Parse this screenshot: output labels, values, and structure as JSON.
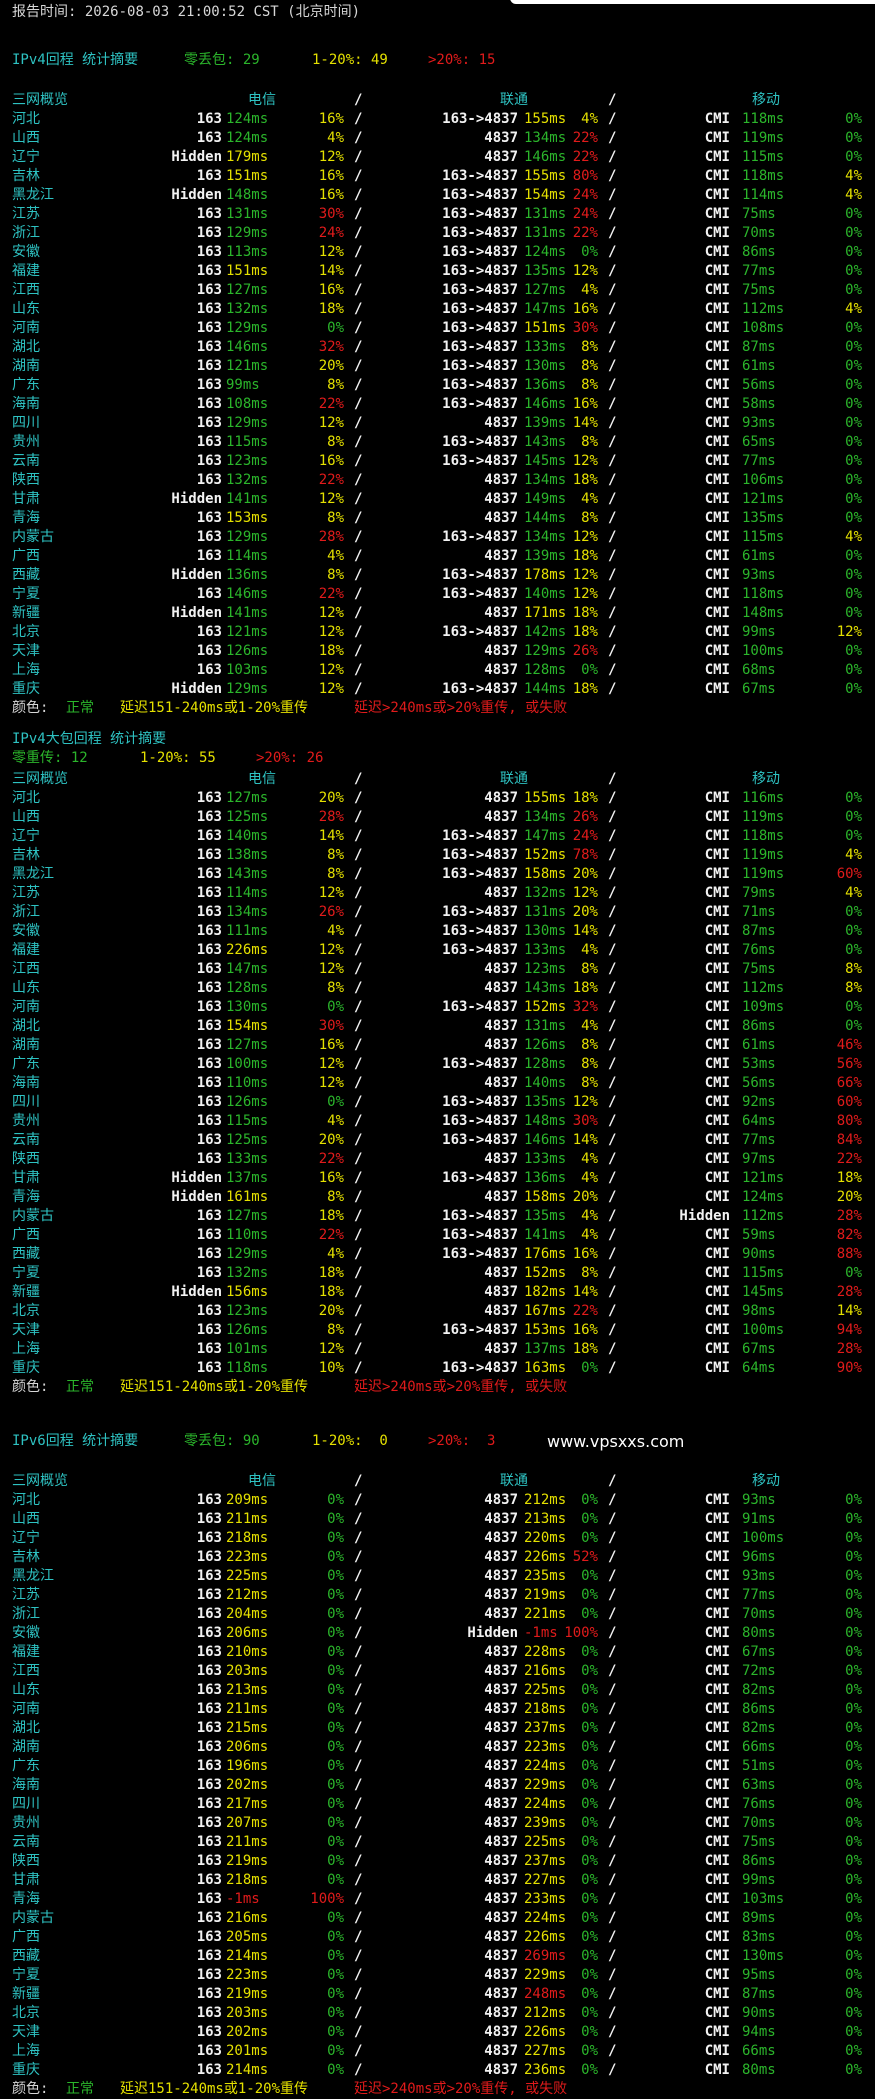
{
  "report_label": "报告时间:",
  "report_time": "2026-08-03 21:00:52 CST (北京时间)",
  "watermark": "www.vpsxxs.com",
  "headers": {
    "region": "三网概览",
    "telecom": "电信",
    "unicom": "联通",
    "mobile": "移动",
    "slash": "/"
  },
  "legend": {
    "label": "颜色:",
    "normal": "正常",
    "warn": "延迟151-240ms或1-20%重传",
    "bad": "延迟>240ms或>20%重传, 或失败"
  },
  "sections": [
    {
      "title": "IPv4回程",
      "subtitle": "统计摘要",
      "summary": [
        {
          "text": "零丢包: 29",
          "tone": "g"
        },
        {
          "text": "1-20%: 49",
          "tone": "y"
        },
        {
          "text": ">20%: 15",
          "tone": "rd"
        }
      ],
      "rows": [
        [
          "河北",
          "163",
          "124ms",
          "16%",
          "163->4837",
          "155ms",
          "4%",
          "CMI",
          "118ms",
          "0%"
        ],
        [
          "山西",
          "163",
          "124ms",
          "4%",
          "4837",
          "134ms",
          "22%",
          "CMI",
          "119ms",
          "0%"
        ],
        [
          "辽宁",
          "Hidden",
          "179ms",
          "12%",
          "4837",
          "146ms",
          "22%",
          "CMI",
          "115ms",
          "0%"
        ],
        [
          "吉林",
          "163",
          "151ms",
          "16%",
          "163->4837",
          "155ms",
          "80%",
          "CMI",
          "118ms",
          "4%"
        ],
        [
          "黑龙江",
          "Hidden",
          "148ms",
          "16%",
          "163->4837",
          "154ms",
          "24%",
          "CMI",
          "114ms",
          "4%"
        ],
        [
          "江苏",
          "163",
          "131ms",
          "30%",
          "163->4837",
          "131ms",
          "24%",
          "CMI",
          "75ms",
          "0%"
        ],
        [
          "浙江",
          "163",
          "129ms",
          "24%",
          "163->4837",
          "131ms",
          "22%",
          "CMI",
          "70ms",
          "0%"
        ],
        [
          "安徽",
          "163",
          "113ms",
          "12%",
          "163->4837",
          "124ms",
          "0%",
          "CMI",
          "86ms",
          "0%"
        ],
        [
          "福建",
          "163",
          "151ms",
          "14%",
          "163->4837",
          "135ms",
          "12%",
          "CMI",
          "77ms",
          "0%"
        ],
        [
          "江西",
          "163",
          "127ms",
          "16%",
          "163->4837",
          "127ms",
          "4%",
          "CMI",
          "75ms",
          "0%"
        ],
        [
          "山东",
          "163",
          "132ms",
          "18%",
          "163->4837",
          "147ms",
          "16%",
          "CMI",
          "112ms",
          "4%"
        ],
        [
          "河南",
          "163",
          "129ms",
          "0%",
          "163->4837",
          "151ms",
          "30%",
          "CMI",
          "108ms",
          "0%"
        ],
        [
          "湖北",
          "163",
          "146ms",
          "32%",
          "163->4837",
          "133ms",
          "8%",
          "CMI",
          "87ms",
          "0%"
        ],
        [
          "湖南",
          "163",
          "121ms",
          "20%",
          "163->4837",
          "130ms",
          "8%",
          "CMI",
          "61ms",
          "0%"
        ],
        [
          "广东",
          "163",
          "99ms",
          "8%",
          "163->4837",
          "136ms",
          "8%",
          "CMI",
          "56ms",
          "0%"
        ],
        [
          "海南",
          "163",
          "108ms",
          "22%",
          "163->4837",
          "146ms",
          "16%",
          "CMI",
          "58ms",
          "0%"
        ],
        [
          "四川",
          "163",
          "129ms",
          "12%",
          "4837",
          "139ms",
          "14%",
          "CMI",
          "93ms",
          "0%"
        ],
        [
          "贵州",
          "163",
          "115ms",
          "8%",
          "163->4837",
          "143ms",
          "8%",
          "CMI",
          "65ms",
          "0%"
        ],
        [
          "云南",
          "163",
          "123ms",
          "16%",
          "163->4837",
          "145ms",
          "12%",
          "CMI",
          "77ms",
          "0%"
        ],
        [
          "陕西",
          "163",
          "132ms",
          "22%",
          "4837",
          "134ms",
          "18%",
          "CMI",
          "106ms",
          "0%"
        ],
        [
          "甘肃",
          "Hidden",
          "141ms",
          "12%",
          "4837",
          "149ms",
          "4%",
          "CMI",
          "121ms",
          "0%"
        ],
        [
          "青海",
          "163",
          "153ms",
          "8%",
          "4837",
          "144ms",
          "8%",
          "CMI",
          "135ms",
          "0%"
        ],
        [
          "内蒙古",
          "163",
          "129ms",
          "28%",
          "163->4837",
          "134ms",
          "12%",
          "CMI",
          "115ms",
          "4%"
        ],
        [
          "广西",
          "163",
          "114ms",
          "4%",
          "4837",
          "139ms",
          "18%",
          "CMI",
          "61ms",
          "0%"
        ],
        [
          "西藏",
          "Hidden",
          "136ms",
          "8%",
          "163->4837",
          "178ms",
          "12%",
          "CMI",
          "93ms",
          "0%"
        ],
        [
          "宁夏",
          "163",
          "146ms",
          "22%",
          "163->4837",
          "140ms",
          "12%",
          "CMI",
          "118ms",
          "0%"
        ],
        [
          "新疆",
          "Hidden",
          "141ms",
          "12%",
          "4837",
          "171ms",
          "18%",
          "CMI",
          "148ms",
          "0%"
        ],
        [
          "北京",
          "163",
          "121ms",
          "12%",
          "163->4837",
          "142ms",
          "18%",
          "CMI",
          "99ms",
          "12%"
        ],
        [
          "天津",
          "163",
          "126ms",
          "18%",
          "4837",
          "129ms",
          "26%",
          "CMI",
          "100ms",
          "0%"
        ],
        [
          "上海",
          "163",
          "103ms",
          "12%",
          "4837",
          "128ms",
          "0%",
          "CMI",
          "68ms",
          "0%"
        ],
        [
          "重庆",
          "Hidden",
          "129ms",
          "12%",
          "163->4837",
          "144ms",
          "18%",
          "CMI",
          "67ms",
          "0%"
        ]
      ]
    },
    {
      "title": "IPv4大包回程",
      "subtitle": "统计摘要",
      "summary": [
        {
          "text": "零重传: 12",
          "tone": "g"
        },
        {
          "text": "1-20%: 55",
          "tone": "y"
        },
        {
          "text": ">20%: 26",
          "tone": "rd"
        }
      ],
      "rows": [
        [
          "河北",
          "163",
          "127ms",
          "20%",
          "4837",
          "155ms",
          "18%",
          "CMI",
          "116ms",
          "0%"
        ],
        [
          "山西",
          "163",
          "125ms",
          "28%",
          "4837",
          "134ms",
          "26%",
          "CMI",
          "119ms",
          "0%"
        ],
        [
          "辽宁",
          "163",
          "140ms",
          "14%",
          "163->4837",
          "147ms",
          "24%",
          "CMI",
          "118ms",
          "0%"
        ],
        [
          "吉林",
          "163",
          "138ms",
          "8%",
          "163->4837",
          "152ms",
          "78%",
          "CMI",
          "119ms",
          "4%"
        ],
        [
          "黑龙江",
          "163",
          "143ms",
          "8%",
          "163->4837",
          "158ms",
          "20%",
          "CMI",
          "119ms",
          "60%"
        ],
        [
          "江苏",
          "163",
          "114ms",
          "12%",
          "4837",
          "132ms",
          "12%",
          "CMI",
          "79ms",
          "4%"
        ],
        [
          "浙江",
          "163",
          "134ms",
          "26%",
          "163->4837",
          "131ms",
          "20%",
          "CMI",
          "71ms",
          "0%"
        ],
        [
          "安徽",
          "163",
          "111ms",
          "4%",
          "163->4837",
          "130ms",
          "14%",
          "CMI",
          "87ms",
          "0%"
        ],
        [
          "福建",
          "163",
          "226ms",
          "12%",
          "163->4837",
          "133ms",
          "4%",
          "CMI",
          "76ms",
          "0%"
        ],
        [
          "江西",
          "163",
          "147ms",
          "12%",
          "4837",
          "123ms",
          "8%",
          "CMI",
          "75ms",
          "8%"
        ],
        [
          "山东",
          "163",
          "128ms",
          "8%",
          "4837",
          "143ms",
          "18%",
          "CMI",
          "112ms",
          "8%"
        ],
        [
          "河南",
          "163",
          "130ms",
          "0%",
          "163->4837",
          "152ms",
          "32%",
          "CMI",
          "109ms",
          "0%"
        ],
        [
          "湖北",
          "163",
          "154ms",
          "30%",
          "4837",
          "131ms",
          "4%",
          "CMI",
          "86ms",
          "0%"
        ],
        [
          "湖南",
          "163",
          "127ms",
          "16%",
          "4837",
          "126ms",
          "8%",
          "CMI",
          "61ms",
          "46%"
        ],
        [
          "广东",
          "163",
          "100ms",
          "12%",
          "163->4837",
          "128ms",
          "8%",
          "CMI",
          "53ms",
          "56%"
        ],
        [
          "海南",
          "163",
          "110ms",
          "12%",
          "4837",
          "140ms",
          "8%",
          "CMI",
          "56ms",
          "66%"
        ],
        [
          "四川",
          "163",
          "126ms",
          "0%",
          "163->4837",
          "135ms",
          "12%",
          "CMI",
          "92ms",
          "60%"
        ],
        [
          "贵州",
          "163",
          "115ms",
          "4%",
          "163->4837",
          "148ms",
          "30%",
          "CMI",
          "64ms",
          "80%"
        ],
        [
          "云南",
          "163",
          "125ms",
          "20%",
          "163->4837",
          "146ms",
          "14%",
          "CMI",
          "77ms",
          "84%"
        ],
        [
          "陕西",
          "163",
          "133ms",
          "22%",
          "4837",
          "133ms",
          "4%",
          "CMI",
          "97ms",
          "22%"
        ],
        [
          "甘肃",
          "Hidden",
          "137ms",
          "16%",
          "163->4837",
          "136ms",
          "4%",
          "CMI",
          "121ms",
          "18%"
        ],
        [
          "青海",
          "Hidden",
          "161ms",
          "8%",
          "4837",
          "158ms",
          "20%",
          "CMI",
          "124ms",
          "20%"
        ],
        [
          "内蒙古",
          "163",
          "127ms",
          "18%",
          "163->4837",
          "135ms",
          "4%",
          "Hidden",
          "112ms",
          "28%"
        ],
        [
          "广西",
          "163",
          "110ms",
          "22%",
          "163->4837",
          "141ms",
          "4%",
          "CMI",
          "59ms",
          "82%"
        ],
        [
          "西藏",
          "163",
          "129ms",
          "4%",
          "163->4837",
          "176ms",
          "16%",
          "CMI",
          "90ms",
          "88%"
        ],
        [
          "宁夏",
          "163",
          "132ms",
          "18%",
          "4837",
          "152ms",
          "8%",
          "CMI",
          "115ms",
          "0%"
        ],
        [
          "新疆",
          "Hidden",
          "156ms",
          "18%",
          "4837",
          "182ms",
          "14%",
          "CMI",
          "145ms",
          "28%"
        ],
        [
          "北京",
          "163",
          "123ms",
          "20%",
          "4837",
          "167ms",
          "22%",
          "CMI",
          "98ms",
          "14%"
        ],
        [
          "天津",
          "163",
          "126ms",
          "8%",
          "163->4837",
          "153ms",
          "16%",
          "CMI",
          "100ms",
          "94%"
        ],
        [
          "上海",
          "163",
          "101ms",
          "12%",
          "4837",
          "137ms",
          "18%",
          "CMI",
          "67ms",
          "28%"
        ],
        [
          "重庆",
          "163",
          "118ms",
          "10%",
          "163->4837",
          "163ms",
          "0%",
          "CMI",
          "64ms",
          "90%"
        ]
      ]
    },
    {
      "title": "IPv6回程",
      "subtitle": "统计摘要",
      "summary": [
        {
          "text": "零丢包: 90",
          "tone": "g"
        },
        {
          "text": "1-20%:  0",
          "tone": "y"
        },
        {
          "text": ">20%:  3",
          "tone": "rd"
        }
      ],
      "rows": [
        [
          "河北",
          "163",
          "209ms",
          "0%",
          "4837",
          "212ms",
          "0%",
          "CMI",
          "93ms",
          "0%"
        ],
        [
          "山西",
          "163",
          "211ms",
          "0%",
          "4837",
          "213ms",
          "0%",
          "CMI",
          "91ms",
          "0%"
        ],
        [
          "辽宁",
          "163",
          "218ms",
          "0%",
          "4837",
          "220ms",
          "0%",
          "CMI",
          "100ms",
          "0%"
        ],
        [
          "吉林",
          "163",
          "223ms",
          "0%",
          "4837",
          "226ms",
          "52%",
          "CMI",
          "96ms",
          "0%"
        ],
        [
          "黑龙江",
          "163",
          "225ms",
          "0%",
          "4837",
          "235ms",
          "0%",
          "CMI",
          "93ms",
          "0%"
        ],
        [
          "江苏",
          "163",
          "212ms",
          "0%",
          "4837",
          "219ms",
          "0%",
          "CMI",
          "77ms",
          "0%"
        ],
        [
          "浙江",
          "163",
          "204ms",
          "0%",
          "4837",
          "221ms",
          "0%",
          "CMI",
          "70ms",
          "0%"
        ],
        [
          "安徽",
          "163",
          "206ms",
          "0%",
          "Hidden",
          "-1ms",
          "100%",
          "CMI",
          "80ms",
          "0%"
        ],
        [
          "福建",
          "163",
          "210ms",
          "0%",
          "4837",
          "228ms",
          "0%",
          "CMI",
          "67ms",
          "0%"
        ],
        [
          "江西",
          "163",
          "203ms",
          "0%",
          "4837",
          "216ms",
          "0%",
          "CMI",
          "72ms",
          "0%"
        ],
        [
          "山东",
          "163",
          "213ms",
          "0%",
          "4837",
          "225ms",
          "0%",
          "CMI",
          "82ms",
          "0%"
        ],
        [
          "河南",
          "163",
          "211ms",
          "0%",
          "4837",
          "218ms",
          "0%",
          "CMI",
          "86ms",
          "0%"
        ],
        [
          "湖北",
          "163",
          "215ms",
          "0%",
          "4837",
          "237ms",
          "0%",
          "CMI",
          "82ms",
          "0%"
        ],
        [
          "湖南",
          "163",
          "206ms",
          "0%",
          "4837",
          "223ms",
          "0%",
          "CMI",
          "66ms",
          "0%"
        ],
        [
          "广东",
          "163",
          "196ms",
          "0%",
          "4837",
          "224ms",
          "0%",
          "CMI",
          "51ms",
          "0%"
        ],
        [
          "海南",
          "163",
          "202ms",
          "0%",
          "4837",
          "229ms",
          "0%",
          "CMI",
          "63ms",
          "0%"
        ],
        [
          "四川",
          "163",
          "217ms",
          "0%",
          "4837",
          "224ms",
          "0%",
          "CMI",
          "76ms",
          "0%"
        ],
        [
          "贵州",
          "163",
          "207ms",
          "0%",
          "4837",
          "239ms",
          "0%",
          "CMI",
          "70ms",
          "0%"
        ],
        [
          "云南",
          "163",
          "211ms",
          "0%",
          "4837",
          "225ms",
          "0%",
          "CMI",
          "75ms",
          "0%"
        ],
        [
          "陕西",
          "163",
          "219ms",
          "0%",
          "4837",
          "237ms",
          "0%",
          "CMI",
          "86ms",
          "0%"
        ],
        [
          "甘肃",
          "163",
          "218ms",
          "0%",
          "4837",
          "227ms",
          "0%",
          "CMI",
          "99ms",
          "0%"
        ],
        [
          "青海",
          "163",
          "-1ms",
          "100%",
          "4837",
          "233ms",
          "0%",
          "CMI",
          "103ms",
          "0%"
        ],
        [
          "内蒙古",
          "163",
          "216ms",
          "0%",
          "4837",
          "224ms",
          "0%",
          "CMI",
          "89ms",
          "0%"
        ],
        [
          "广西",
          "163",
          "205ms",
          "0%",
          "4837",
          "226ms",
          "0%",
          "CMI",
          "83ms",
          "0%"
        ],
        [
          "西藏",
          "163",
          "214ms",
          "0%",
          "4837",
          "269ms",
          "0%",
          "CMI",
          "130ms",
          "0%"
        ],
        [
          "宁夏",
          "163",
          "223ms",
          "0%",
          "4837",
          "229ms",
          "0%",
          "CMI",
          "95ms",
          "0%"
        ],
        [
          "新疆",
          "163",
          "219ms",
          "0%",
          "4837",
          "248ms",
          "0%",
          "CMI",
          "87ms",
          "0%"
        ],
        [
          "北京",
          "163",
          "203ms",
          "0%",
          "4837",
          "212ms",
          "0%",
          "CMI",
          "90ms",
          "0%"
        ],
        [
          "天津",
          "163",
          "202ms",
          "0%",
          "4837",
          "226ms",
          "0%",
          "CMI",
          "94ms",
          "0%"
        ],
        [
          "上海",
          "163",
          "201ms",
          "0%",
          "4837",
          "227ms",
          "0%",
          "CMI",
          "66ms",
          "0%"
        ],
        [
          "重庆",
          "163",
          "214ms",
          "0%",
          "4837",
          "236ms",
          "0%",
          "CMI",
          "80ms",
          "0%"
        ]
      ]
    }
  ]
}
